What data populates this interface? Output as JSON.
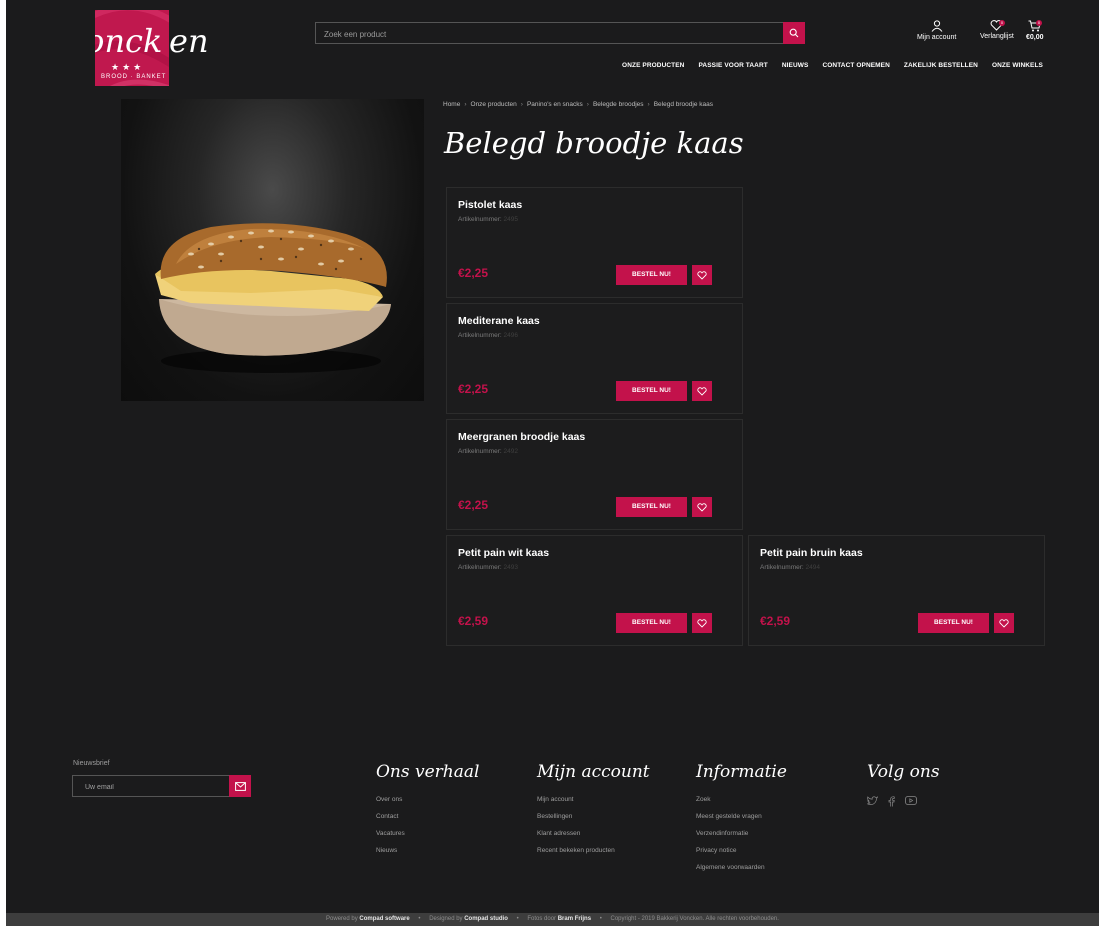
{
  "brand": {
    "logo_text": "Vonck",
    "logo_tail": "en",
    "logo_stars": "★★★",
    "logo_sub": "BROOD · BANKET",
    "accent": "#c3124b"
  },
  "search": {
    "placeholder": "Zoek een product"
  },
  "header": {
    "account_label": "Mijn account",
    "wishlist_label": "Verlanglijst",
    "wishlist_count": "0",
    "cart_total": "€0,00",
    "cart_count": "0"
  },
  "nav": [
    "ONZE PRODUCTEN",
    "PASSIE VOOR TAART",
    "NIEUWS",
    "CONTACT OPNEMEN",
    "ZAKELIJK BESTELLEN",
    "ONZE WINKELS"
  ],
  "breadcrumb": [
    "Home",
    "Onze producten",
    "Panino's en snacks",
    "Belegde broodjes",
    "Belegd broodje kaas"
  ],
  "page_title": "Belegd broodje kaas",
  "article_label": "Artikelnummer:",
  "order_label": "BESTEL NU!",
  "products": [
    {
      "name": "Pistolet kaas",
      "number": "2495",
      "price": "€2,25"
    },
    {
      "name": "Mediterane kaas",
      "number": "2496",
      "price": "€2,25"
    },
    {
      "name": "Meergranen broodje kaas",
      "number": "2492",
      "price": "€2,25"
    },
    {
      "name": "Petit pain wit kaas",
      "number": "2493",
      "price": "€2,59"
    },
    {
      "name": "Petit pain bruin kaas",
      "number": "2494",
      "price": "€2,59"
    }
  ],
  "footer": {
    "newsletter_label": "Nieuwsbrief",
    "newsletter_placeholder": "Uw email",
    "columns": [
      {
        "title": "Ons verhaal",
        "links": [
          "Over ons",
          "Contact",
          "Vacatures",
          "Nieuws"
        ]
      },
      {
        "title": "Mijn account",
        "links": [
          "Mijn account",
          "Bestellingen",
          "Klant adressen",
          "Recent bekeken producten"
        ]
      },
      {
        "title": "Informatie",
        "links": [
          "Zoek",
          "Meest gestelde vragen",
          "Verzendinformatie",
          "Privacy notice",
          "Algemene voorwaarden"
        ]
      }
    ],
    "social_title": "Volg ons",
    "social_icons": [
      "twitter-icon",
      "facebook-icon",
      "youtube-icon"
    ]
  },
  "bottom_bar": {
    "powered_prefix": "Powered by",
    "powered_name": "Compad software",
    "designed_prefix": "Designed by",
    "designed_name": "Compad studio",
    "photo_prefix": "Fotos door",
    "photo_name": "Bram Frijns",
    "copyright": "Copyright - 2019 Bakkerij Voncken. Alle rechten voorbehouden."
  }
}
